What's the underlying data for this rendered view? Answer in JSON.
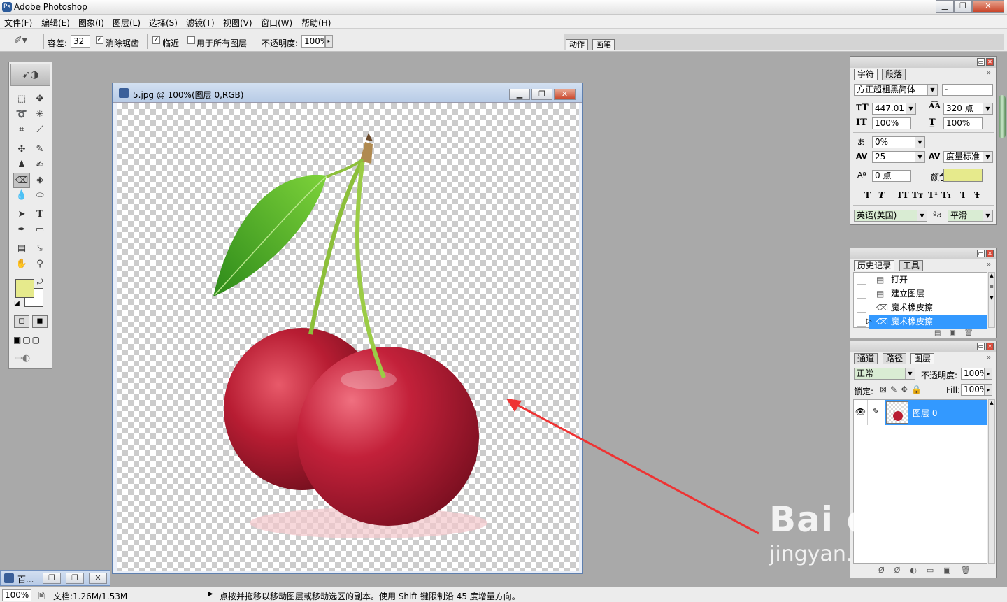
{
  "app": {
    "title": "Adobe Photoshop",
    "icon": "photoshop-icon"
  },
  "window_controls": {
    "minimize": "▁",
    "restore": "❐",
    "close": "✕"
  },
  "menus": [
    "文件(F)",
    "编辑(E)",
    "图象(I)",
    "图层(L)",
    "选择(S)",
    "滤镜(T)",
    "视图(V)",
    "窗口(W)",
    "帮助(H)"
  ],
  "options": {
    "tolerance_label": "容差:",
    "tolerance_value": "32",
    "antialias_label": "消除锯齿",
    "antialias_checked": true,
    "contiguous_label": "临近",
    "contiguous_checked": true,
    "all_layers_label": "用于所有图层",
    "all_layers_checked": false,
    "opacity_label": "不透明度:",
    "opacity_value": "100%"
  },
  "palette_well": {
    "tabs": [
      "动作",
      "画笔"
    ]
  },
  "document": {
    "title": "5.jpg @ 100%(图层 0,RGB)"
  },
  "character_panel": {
    "tabs": [
      "字符",
      "段落"
    ],
    "font_family": "方正超粗黑简体",
    "font_style": "-",
    "font_size": "447.01 点",
    "leading": "320 点",
    "vertical_scale": "100%",
    "horizontal_scale": "100%",
    "tsume": "0%",
    "kerning": "25",
    "tracking": "度量标准",
    "baseline_shift": "0 点",
    "color_label": "颜色:",
    "text_color": "#e6ea8c",
    "style_buttons": [
      "T",
      "T",
      "TT",
      "Tт",
      "T¹",
      "T₁",
      "T",
      "Ŧ"
    ],
    "language": "英语(美国)",
    "aa_label": "ªa",
    "antialias": "平滑"
  },
  "history_panel": {
    "tabs": [
      "历史记录",
      "工具"
    ],
    "items": [
      {
        "label": "打开",
        "icon": "document-icon",
        "selected": false
      },
      {
        "label": "建立图层",
        "icon": "document-icon",
        "selected": false
      },
      {
        "label": "魔术橡皮擦",
        "icon": "magic-eraser-icon",
        "selected": false
      },
      {
        "label": "魔术橡皮擦",
        "icon": "magic-eraser-icon",
        "selected": true
      }
    ]
  },
  "layers_panel": {
    "tabs": [
      "通道",
      "路径",
      "图层"
    ],
    "blend_mode": "正常",
    "opacity_label": "不透明度:",
    "opacity": "100%",
    "lock_label": "锁定:",
    "fill_label": "Fill:",
    "fill": "100%",
    "layers": [
      {
        "name": "图层 0",
        "visible": true,
        "selected": true
      }
    ]
  },
  "taskbar": {
    "minimized_title": "百..."
  },
  "status": {
    "zoom": "100%",
    "doc_size": "文档:1.26M/1.53M",
    "hint": "点按并拖移以移动图层或移动选区的副本。使用 Shift 键限制沿 45 度增量方向。"
  },
  "colors": {
    "foreground": "#e6ea8c",
    "background": "#ffffff",
    "selection": "#3399ff",
    "annotation_arrow": "#ee3333"
  },
  "watermark": {
    "line1": "Bai du 经验",
    "line2": "jingyan.baidu.com"
  }
}
